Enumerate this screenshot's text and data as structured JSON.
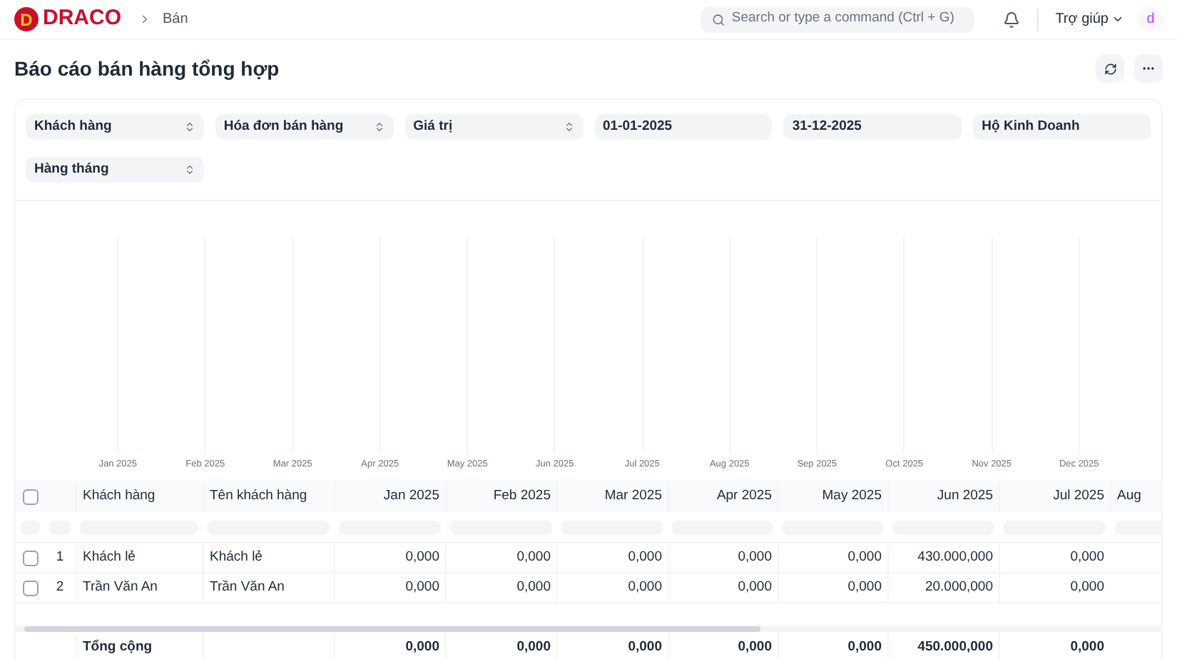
{
  "topbar": {
    "logo_letter": "D",
    "logo_text": "DRACO",
    "breadcrumb": "Bán",
    "search": {
      "placeholder": "Search or type a command (Ctrl + G)"
    },
    "help": "Trợ giúp",
    "avatar": "d"
  },
  "page": {
    "title": "Báo cáo bán hàng tổng hợp"
  },
  "filters": [
    {
      "kind": "select",
      "value": "Khách hàng"
    },
    {
      "kind": "select",
      "value": "Hóa đơn bán hàng"
    },
    {
      "kind": "select",
      "value": "Giá trị"
    },
    {
      "kind": "text",
      "value": "01-01-2025"
    },
    {
      "kind": "text",
      "value": "31-12-2025"
    },
    {
      "kind": "text",
      "value": "Hộ Kinh Doanh"
    },
    {
      "kind": "select",
      "value": "Hàng tháng"
    }
  ],
  "chart_axis_labels": [
    "Jan 2025",
    "Feb 2025",
    "Mar 2025",
    "Apr 2025",
    "May 2025",
    "Jun 2025",
    "Jul 2025",
    "Aug 2025",
    "Sep 2025",
    "Oct 2025",
    "Nov 2025",
    "Dec 2025"
  ],
  "table": {
    "select_all": {
      "checked": false
    },
    "columns": [
      "Khách hàng",
      "Tên khách hàng",
      "Jan 2025",
      "Feb 2025",
      "Mar 2025",
      "Apr 2025",
      "May 2025",
      "Jun 2025",
      "Jul 2025",
      "Aug"
    ],
    "rows": [
      {
        "checked": false,
        "index": "1",
        "cells": [
          "Khách lẻ",
          "Khách lẻ",
          "0,000",
          "0,000",
          "0,000",
          "0,000",
          "0,000",
          "430.000,000",
          "0,000"
        ]
      },
      {
        "checked": false,
        "index": "2",
        "cells": [
          "Trần Văn An",
          "Trần Văn An",
          "0,000",
          "0,000",
          "0,000",
          "0,000",
          "0,000",
          "20.000,000",
          "0,000"
        ]
      }
    ],
    "total": {
      "label": "Tổng cộng",
      "values": [
        "0,000",
        "0,000",
        "0,000",
        "0,000",
        "0,000",
        "450.000,000",
        "0,000"
      ]
    }
  }
}
